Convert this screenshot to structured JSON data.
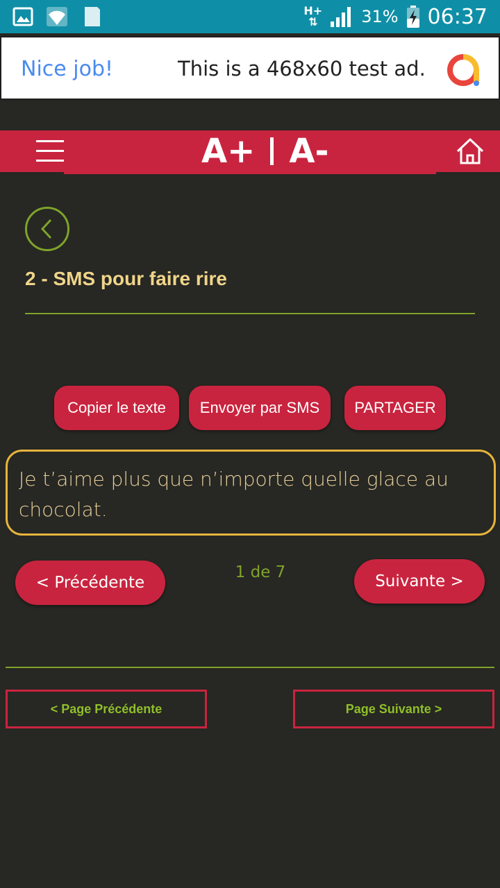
{
  "status_bar": {
    "network_type": "H+",
    "battery_percent": "31%",
    "time": "06:37",
    "icons": [
      "gallery-icon",
      "wifi-icon",
      "sim-icon",
      "signal-icon",
      "battery-charging-icon"
    ]
  },
  "ad": {
    "nice_job": "Nice job!",
    "text": "This is a 468x60 test ad."
  },
  "header": {
    "font_increase": "A+",
    "font_decrease": "A-"
  },
  "page": {
    "title": "2 - SMS pour faire rire"
  },
  "actions": {
    "copy": "Copier le texte",
    "sms": "Envoyer par SMS",
    "share": "PARTAGER"
  },
  "message": {
    "text": "Je t’aime plus que n’importe quelle glace au chocolat."
  },
  "pager": {
    "prev": "< Précédente",
    "next": "Suivante >",
    "counter": "1 de 7"
  },
  "page_nav": {
    "prev": "< Page Précédente",
    "next": "Page Suivante >"
  },
  "colors": {
    "status_bar": "#0f8fa7",
    "accent_red": "#c9243f",
    "accent_green": "#7fa32a",
    "title_yellow": "#f0d58a",
    "message_border": "#e6b43c",
    "background": "#272723"
  }
}
